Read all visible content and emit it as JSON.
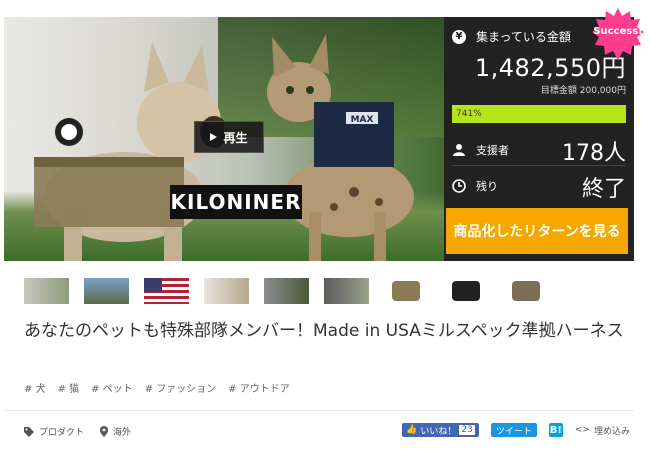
{
  "hero": {
    "play_label": "再生",
    "brand_logo_text": "KILONINER"
  },
  "stats": {
    "collected_label": "集まっている金額",
    "collected_amount": "1,482,550円",
    "goal_label": "目標金額 200,000円",
    "progress_percent": 741,
    "progress_text": "741%",
    "supporters_label": "支援者",
    "supporters_value": "178人",
    "remaining_label": "残り",
    "remaining_value": "終了",
    "cta_label": "商品化したリターンを見る",
    "badge_text": "Success!",
    "colors": {
      "panel_bg": "#222222",
      "progress_fill": "#b5e61d",
      "cta_bg": "#f5a700",
      "badge_bg": "#ff3d8f"
    }
  },
  "thumbnails": [
    {
      "name": "thumb-1"
    },
    {
      "name": "thumb-2"
    },
    {
      "name": "thumb-3"
    },
    {
      "name": "thumb-4"
    },
    {
      "name": "thumb-5"
    },
    {
      "name": "thumb-6"
    },
    {
      "name": "thumb-7"
    },
    {
      "name": "thumb-8"
    },
    {
      "name": "thumb-9"
    }
  ],
  "project": {
    "title": "あなたのペットも特殊部隊メンバー！Made in USAミルスペック準拠ハーネス",
    "tags": [
      "# 犬",
      "# 猫",
      "# ペット",
      "# ファッション",
      "# アウトドア"
    ],
    "category": "プロダクト",
    "location": "海外"
  },
  "social": {
    "like_label": "いいね！",
    "like_count": "23",
    "tweet_label": "ツイート",
    "hatena_label": "B!",
    "embed_label": "埋め込み"
  }
}
